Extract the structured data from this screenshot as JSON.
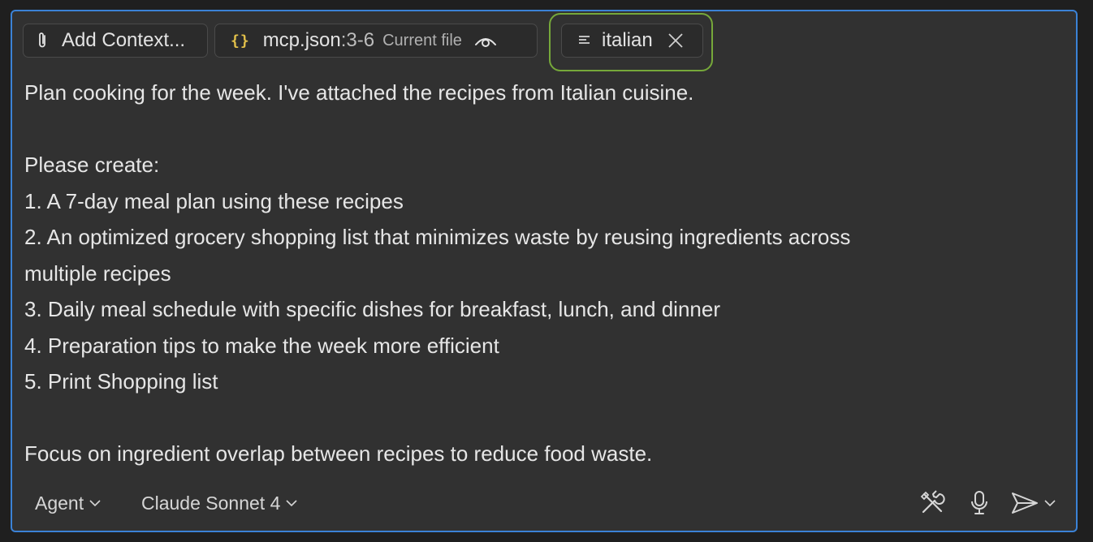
{
  "context": {
    "add_label": "Add Context...",
    "file_name": "mcp.json",
    "file_range": ":3-6",
    "file_tag": "Current file",
    "attachment_name": "italian"
  },
  "message": {
    "lines": [
      "Plan cooking for the week. I've attached the recipes from Italian cuisine.",
      "",
      "Please create:",
      "1. A 7-day meal plan using these recipes",
      "2. An optimized grocery shopping list that minimizes waste by reusing ingredients across",
      "multiple recipes",
      "3. Daily meal schedule with specific dishes for breakfast, lunch, and dinner",
      "4. Preparation tips to make the week more efficient",
      "5. Print Shopping list",
      "",
      "Focus on ingredient overlap between recipes to reduce food waste."
    ]
  },
  "toolbar": {
    "mode_label": "Agent",
    "model_label": "Claude Sonnet 4"
  },
  "icons": {
    "attach": "paperclip-icon",
    "json": "braces-icon",
    "eye": "eye-icon",
    "text_file": "text-file-icon",
    "close": "close-icon",
    "chevron": "chevron-down-icon",
    "tools": "tools-icon",
    "mic": "microphone-icon",
    "send": "send-icon"
  },
  "colors": {
    "panel_background": "#313131",
    "panel_border": "#3b82d6",
    "attachment_highlight": "#76a83a",
    "json_braces": "#e2c04a",
    "text": "#e6e6e6"
  }
}
